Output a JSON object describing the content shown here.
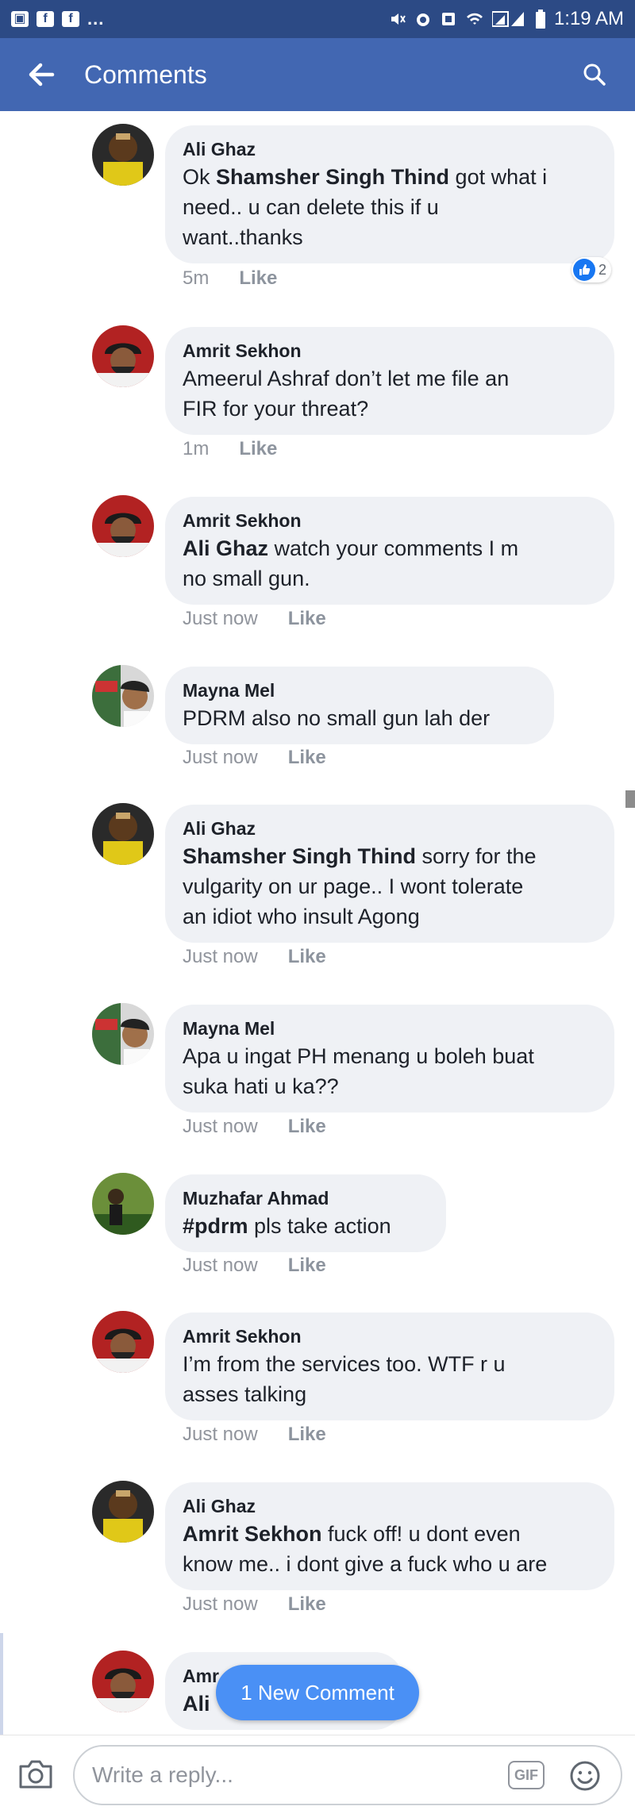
{
  "status_bar": {
    "left_icons": [
      "image-icon",
      "facebook-icon",
      "facebook-icon"
    ],
    "dots": "...",
    "time": "1:19 AM",
    "right_icons": [
      "mute-icon",
      "alarm-icon",
      "data-icon",
      "wifi-icon",
      "signal-icon",
      "battery-icon"
    ]
  },
  "header": {
    "title": "Comments",
    "back_icon": "arrow-left-icon",
    "search_icon": "search-icon",
    "color": "#4267b2",
    "status_color": "#2c4a85"
  },
  "comments": [
    {
      "author": "Ali Ghaz",
      "mention": "",
      "lines": [
        "Ok Shamsher Singh Thind got what i",
        "need.. u can delete this if u",
        "want..thanks"
      ],
      "time": "5m",
      "like": "Like",
      "reactions": "2"
    },
    {
      "author": "Amrit Sekhon",
      "lines": [
        "Ameerul Ashraf  don’t let me file an",
        "FIR for your threat?"
      ],
      "time": "1m",
      "like": "Like"
    },
    {
      "author": "Amrit Sekhon",
      "lines": [
        "Ali Ghaz watch your comments I m",
        "no small gun."
      ],
      "time": "Just now",
      "like": "Like"
    },
    {
      "author": "Mayna Mel",
      "lines": [
        "PDRM also no small gun lah der"
      ],
      "time": "Just now",
      "like": "Like"
    },
    {
      "author": "Ali Ghaz",
      "lines": [
        "Shamsher Singh Thind sorry for the",
        "vulgarity on ur page.. I wont tolerate",
        "an idiot who insult Agong"
      ],
      "time": "Just now",
      "like": "Like"
    },
    {
      "author": "Mayna Mel",
      "lines": [
        "Apa u ingat PH menang u boleh buat",
        "suka hati u ka??"
      ],
      "time": "Just now",
      "like": "Like"
    },
    {
      "author": "Muzhafar Ahmad",
      "lines": [
        "#pdrm pls take action"
      ],
      "time": "Just now",
      "like": "Like"
    },
    {
      "author": "Amrit Sekhon",
      "lines": [
        "I’m from the services too. WTF r u",
        "asses talking"
      ],
      "time": "Just now",
      "like": "Like"
    },
    {
      "author": "Ali Ghaz",
      "lines": [
        "Amrit Sekhon fuck off! u dont even",
        "know me.. i dont give a fuck who u are"
      ],
      "time": "Just now",
      "like": "Like"
    },
    {
      "author": "Amr",
      "lines": [
        "Ali"
      ]
    }
  ],
  "new_comment_label": "1 New Comment",
  "reply": {
    "placeholder": "Write a reply...",
    "gif_label": "GIF",
    "camera_icon": "camera-icon",
    "emoji_icon": "emoji-icon"
  },
  "bubble_color": "#eff1f5",
  "new_comment_color": "#4a90f5"
}
